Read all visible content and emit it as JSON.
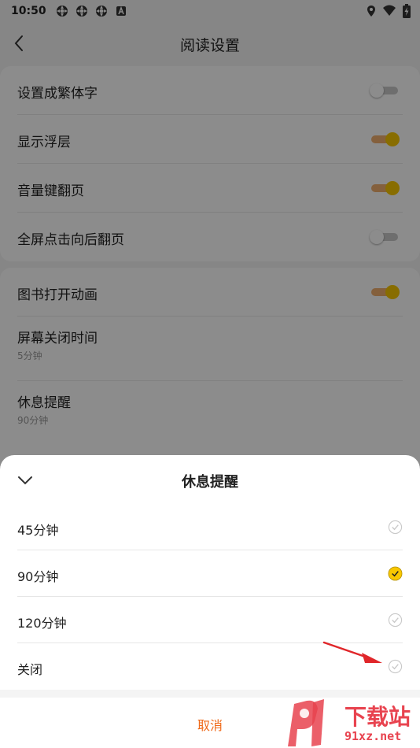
{
  "status_bar": {
    "time": "10:50",
    "icons": [
      "signal-app-icon",
      "signal-app-icon",
      "signal-app-icon",
      "text-a-icon"
    ],
    "right_icons": [
      "location-icon",
      "wifi-icon",
      "battery-charging-icon"
    ]
  },
  "header": {
    "title": "阅读设置",
    "back_icon": "chevron-left-icon"
  },
  "settings_group_1": {
    "items": [
      {
        "label": "设置成繁体字",
        "toggle": "off"
      },
      {
        "label": "显示浮层",
        "toggle": "on"
      },
      {
        "label": "音量键翻页",
        "toggle": "on"
      },
      {
        "label": "全屏点击向后翻页",
        "toggle": "off"
      }
    ]
  },
  "settings_group_2": {
    "items": [
      {
        "label": "图书打开动画",
        "toggle": "on"
      },
      {
        "label": "屏幕关闭时间",
        "value": "5分钟"
      },
      {
        "label": "休息提醒",
        "value": "90分钟"
      }
    ]
  },
  "sheet": {
    "title": "休息提醒",
    "collapse_icon": "chevron-down-icon",
    "options": [
      {
        "label": "45分钟",
        "selected": false
      },
      {
        "label": "90分钟",
        "selected": true
      },
      {
        "label": "120分钟",
        "selected": false
      },
      {
        "label": "关闭",
        "selected": false
      }
    ],
    "cancel_label": "取消"
  },
  "colors": {
    "accent_yellow": "#f8c700",
    "toggle_on_track": "#f0b070",
    "cancel_orange": "#ef6a1a",
    "annotation_red": "#e0262a",
    "watermark_red": "#e8434f"
  },
  "watermark": {
    "brand": "下载站",
    "site": "91xz.net",
    "logo_text": "91"
  }
}
